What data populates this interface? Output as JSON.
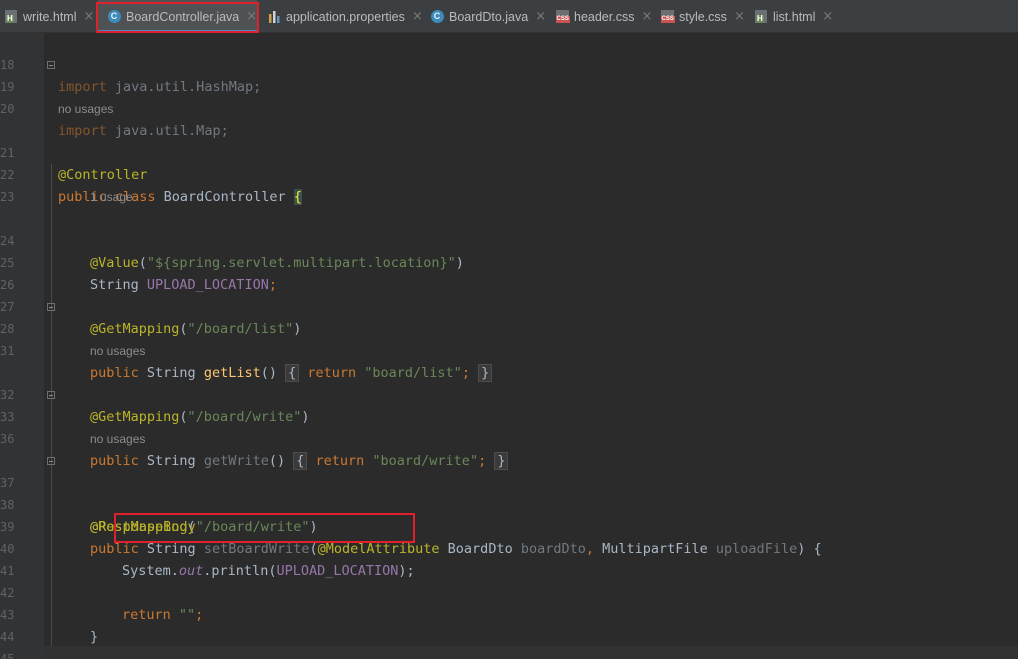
{
  "tabs": [
    {
      "label": "write.html",
      "icon": "html-file-icon",
      "active": false
    },
    {
      "label": "BoardController.java",
      "icon": "java-class-icon",
      "active": true
    },
    {
      "label": "application.properties",
      "icon": "properties-file-icon",
      "active": false
    },
    {
      "label": "BoardDto.java",
      "icon": "java-class-icon",
      "active": false
    },
    {
      "label": "header.css",
      "icon": "css-file-icon",
      "active": false
    },
    {
      "label": "style.css",
      "icon": "css-file-icon",
      "active": false
    },
    {
      "label": "list.html",
      "icon": "html-file-icon",
      "active": false
    }
  ],
  "icon_glyphs": {
    "java": "C",
    "html": "H",
    "css": "CSS",
    "close": "×"
  },
  "editor": {
    "line_numbers": [
      "18",
      "19",
      "20",
      "",
      "21",
      "22",
      "23",
      "",
      "24",
      "25",
      "26",
      "27",
      "28",
      "31",
      "",
      "32",
      "33",
      "36",
      "",
      "37",
      "38",
      "39",
      "40",
      "41",
      "42",
      "43",
      "44",
      "45"
    ],
    "hints": {
      "no_usages_1": "no usages",
      "one_usage": "1 usage",
      "no_usages_2": "no usages",
      "no_usages_3": "no usages"
    },
    "code": {
      "l18_kw": "import",
      "l18_rest": " java.util.HashMap;",
      "l19_kw": "import",
      "l19_rest": " java.util.Map;",
      "l21_ann": "@Controller",
      "l22_kw": "public class",
      "l22_name": " BoardController ",
      "l22_brace": "{",
      "l24_ann": "@Value",
      "l24_open": "(",
      "l24_str": "\"${spring.servlet.multipart.location}\"",
      "l24_close": ")",
      "l25_type": "String ",
      "l25_field": "UPLOAD_LOCATION",
      "l25_semi": ";",
      "l27_ann": "@GetMapping",
      "l27_open": "(",
      "l27_str": "\"/board/list\"",
      "l27_close": ")",
      "l28_kw": "public",
      "l28_type": " String ",
      "l28_fn": "getList",
      "l28_paren": "() ",
      "l28_lb": "{",
      "l28_ret": " return ",
      "l28_str": "\"board/list\"",
      "l28_semi": "; ",
      "l28_rb": "}",
      "l32_ann": "@GetMapping",
      "l32_open": "(",
      "l32_str": "\"/board/write\"",
      "l32_close": ")",
      "l33_kw": "public",
      "l33_type": " String ",
      "l33_fn": "getWrite",
      "l33_paren": "() ",
      "l33_lb": "{",
      "l33_ret": " return ",
      "l33_str": "\"board/write\"",
      "l33_semi": "; ",
      "l33_rb": "}",
      "l37_ann": "@PostMapping",
      "l37_open": "(",
      "l37_str": "\"/board/write\"",
      "l37_close": ")",
      "l38_ann": "@ResponseBody",
      "l39_kw": "public",
      "l39_type": " String ",
      "l39_fn": "setBoardWrite",
      "l39_open": "(",
      "l39_ann": "@ModelAttribute",
      "l39_t1": " BoardDto ",
      "l39_p1": "boardDto",
      "l39_comma": ", ",
      "l39_t2": "MultipartFile ",
      "l39_p2": "uploadFile",
      "l39_close": ") {",
      "l40_sys": "System.",
      "l40_out": "out",
      "l40_call": ".println(",
      "l40_field": "UPLOAD_LOCATION",
      "l40_end": ");",
      "l42_kw": "return ",
      "l42_str": "\"\"",
      "l42_semi": ";",
      "l43_brace": "}",
      "l46_brace": "}"
    }
  }
}
